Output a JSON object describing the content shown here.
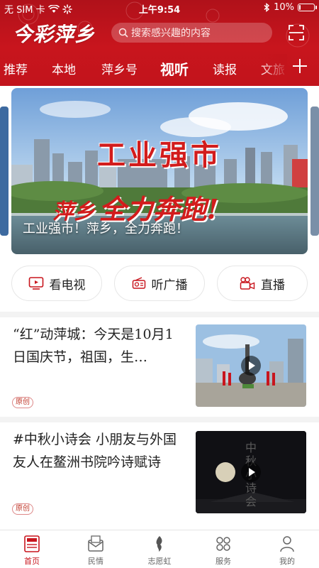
{
  "status_bar": {
    "carrier": "无 SIM 卡",
    "time": "上午9:54",
    "battery": "10%",
    "battery_level": 0.1
  },
  "header": {
    "logo": "今彩萍乡",
    "search_placeholder": "搜索感兴趣的内容",
    "tabs": [
      "推荐",
      "本地",
      "萍乡号",
      "视听",
      "读报",
      "文旅"
    ],
    "active_tab": "视听"
  },
  "banner": {
    "headline": "工业强市",
    "slogan_prefix": "萍乡",
    "slogan_main": "全力奔跑!",
    "caption": "工业强市！萍乡，全力奔跑！"
  },
  "quick_links": [
    {
      "label": "看电视",
      "icon": "tv-icon"
    },
    {
      "label": "听广播",
      "icon": "radio-icon"
    },
    {
      "label": "直播",
      "icon": "live-camera-icon"
    }
  ],
  "news": [
    {
      "title": "“红”动萍城：今天是10月1日国庆节，祖国，生…",
      "badge": "原创"
    },
    {
      "title": "#中秋小诗会 小朋友与外国友人在鳌洲书院吟诗赋诗",
      "badge": "原创",
      "thumb_text": "中秋小诗会"
    }
  ],
  "bottom_nav": [
    {
      "label": "首页",
      "icon": "home-news-icon",
      "active": true
    },
    {
      "label": "民情",
      "icon": "mail-icon",
      "active": false
    },
    {
      "label": "志愿虹",
      "icon": "volunteer-icon",
      "active": false
    },
    {
      "label": "服务",
      "icon": "services-icon",
      "active": false
    },
    {
      "label": "我的",
      "icon": "profile-icon",
      "active": false
    }
  ],
  "colors": {
    "brand_red": "#c8151d",
    "badge_red": "#c0392b"
  }
}
